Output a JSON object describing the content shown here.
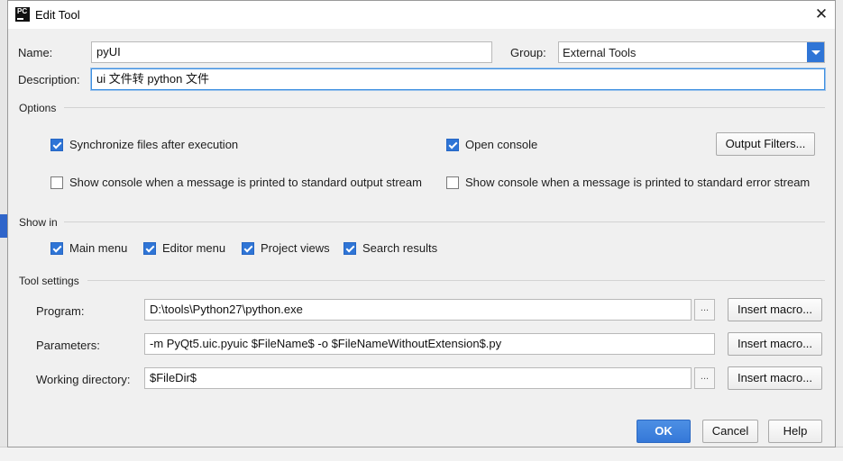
{
  "window": {
    "title": "Edit Tool",
    "app_icon_text": "PC"
  },
  "form": {
    "name_label": "Name:",
    "name_value": "pyUI",
    "group_label": "Group:",
    "group_value": "External Tools",
    "description_label": "Description:",
    "description_value": "ui 文件转 python 文件"
  },
  "options": {
    "section_label": "Options",
    "sync_files": {
      "label": "Synchronize files after execution",
      "checked": true
    },
    "open_console": {
      "label": "Open console",
      "checked": true
    },
    "output_filters_button": "Output Filters...",
    "show_console_stdout": {
      "label": "Show console when a message is printed to standard output stream",
      "checked": false
    },
    "show_console_stderr": {
      "label": "Show console when a message is printed to standard error stream",
      "checked": false
    }
  },
  "show_in": {
    "section_label": "Show in",
    "items": [
      {
        "label": "Main menu",
        "checked": true
      },
      {
        "label": "Editor menu",
        "checked": true
      },
      {
        "label": "Project views",
        "checked": true
      },
      {
        "label": "Search results",
        "checked": true
      }
    ]
  },
  "tool_settings": {
    "section_label": "Tool settings",
    "program_label": "Program:",
    "program_value": "D:\\tools\\Python27\\python.exe",
    "parameters_label": "Parameters:",
    "parameters_value": "-m PyQt5.uic.pyuic  $FileName$ -o $FileNameWithoutExtension$.py",
    "working_dir_label": "Working directory:",
    "working_dir_value": "$FileDir$",
    "browse_label": "...",
    "insert_macro_label": "Insert macro..."
  },
  "footer": {
    "ok": "OK",
    "cancel": "Cancel",
    "help": "Help"
  },
  "colors": {
    "accent": "#2f75d6",
    "focus_border": "#3d8fe1"
  }
}
